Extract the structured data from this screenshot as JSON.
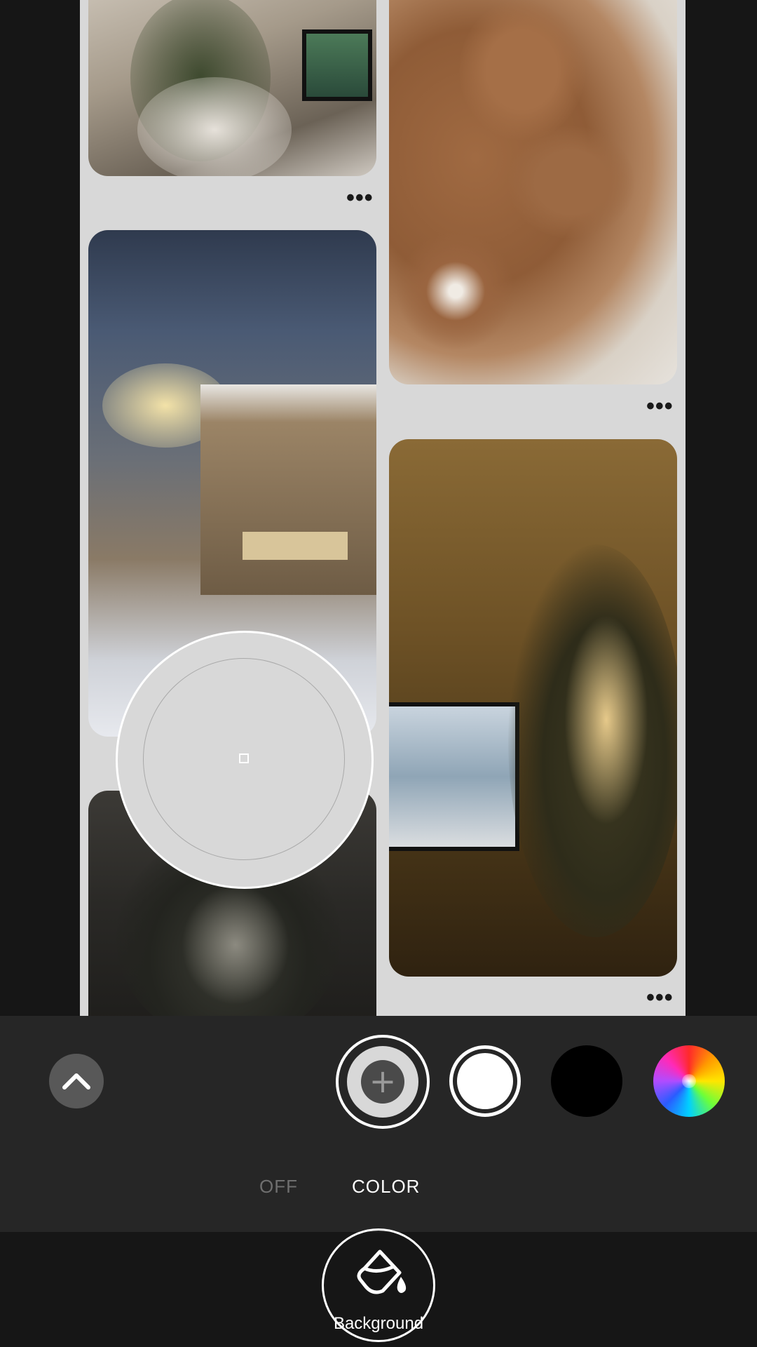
{
  "board": {
    "background_color": "#d8d8d8",
    "pins": [
      {
        "id": "pin-room",
        "menu": "•••"
      },
      {
        "id": "pin-cookies",
        "menu": "•••"
      },
      {
        "id": "pin-market",
        "menu": "•••"
      },
      {
        "id": "pin-tree",
        "menu": "•••"
      }
    ]
  },
  "color_picker": {
    "sampled_color": "#d8d8d8"
  },
  "panel": {
    "collapse_icon": "chevron-up-icon",
    "swatches": [
      {
        "name": "add-color",
        "icon": "plus-icon",
        "plus": "+"
      },
      {
        "name": "white",
        "color": "#ffffff",
        "selected": true
      },
      {
        "name": "black",
        "color": "#000000"
      },
      {
        "name": "custom",
        "icon": "color-wheel-icon"
      }
    ],
    "modes": {
      "off": "OFF",
      "color": "COLOR",
      "active": "COLOR"
    }
  },
  "toolbar": {
    "tool_icon": "paint-bucket-icon",
    "tool_label": "Background"
  }
}
